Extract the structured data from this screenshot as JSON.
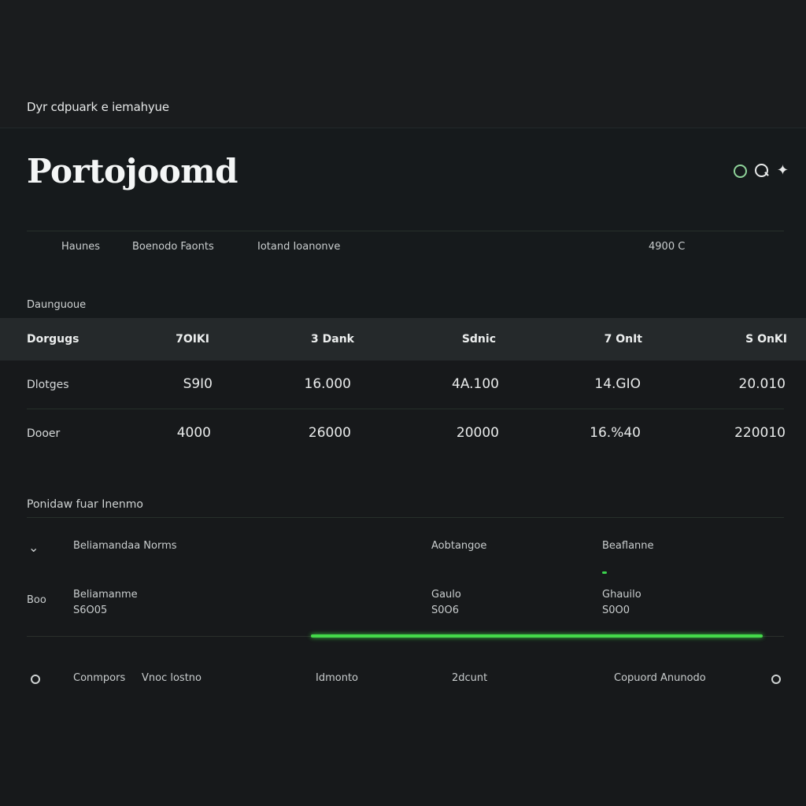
{
  "app": {
    "caption": "Dyr cdpuark e iemahyue"
  },
  "header": {
    "title": "Portojoomd",
    "icons": [
      "status-ring-icon",
      "search-icon",
      "sparkle-icon"
    ],
    "accent": "#8fd49a"
  },
  "nav": {
    "items": [
      "Haunes",
      "Boenodo Faonts",
      "Iotand Ioanonve"
    ],
    "right": "4900 C"
  },
  "table": {
    "section_label": "Daunguoue",
    "headers": [
      "Dorgugs",
      "7OIKI",
      "3 Dank",
      "Sdnic",
      "7 OnIt",
      "S OnKI"
    ],
    "rows": [
      {
        "label": "Dlotges",
        "values": [
          "S9I0",
          "16.000",
          "4A.100",
          "14.GIO",
          "20.010"
        ]
      },
      {
        "label": "Dooer",
        "values": [
          "4000",
          "26000",
          "20000",
          "16.%40",
          "220010"
        ]
      }
    ]
  },
  "list": {
    "section_label": "Ponidaw fuar Inenmo",
    "row1": {
      "label": "Beliamandaa Norms",
      "col2": "Aobtangoe",
      "col3": "Beaflanne"
    },
    "row2": {
      "left": "Boo",
      "label": "Beliamanme",
      "label_sub": "S6O05",
      "col2": "Gaulo",
      "col2_sub": "S0O6",
      "col3": "Ghauilo",
      "col3_sub": "S0O0"
    },
    "progress": 0.6,
    "progress_color": "#44d94a"
  },
  "footer": {
    "items": [
      "Conmpors",
      "Vnoc lostno",
      "Idmonto",
      "2dcunt",
      "Copuord Anunodo"
    ]
  }
}
